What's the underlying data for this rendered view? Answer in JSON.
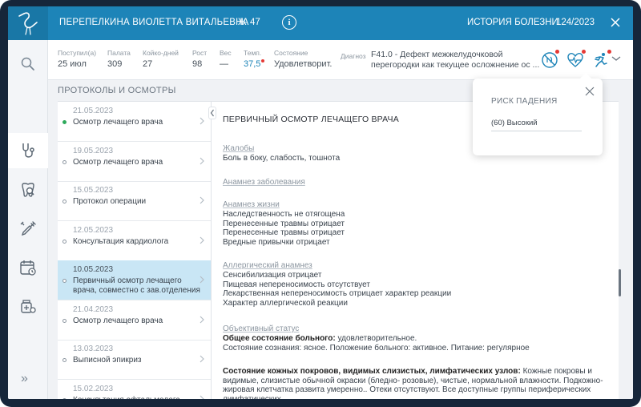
{
  "topbar": {
    "patient_name": "ПЕРЕПЕЛКИНА ВИОЛЕТТА ВИТАЛЬЕВНА",
    "sex": "Ж",
    "age": "47",
    "info_icon": "i",
    "history_label": "ИСТОРИЯ БОЛЕЗНИ",
    "history_number": "124/2023"
  },
  "patient_info": {
    "admitted_label": "Поступил(а)",
    "admitted_value": "25 июл",
    "ward_label": "Палата",
    "ward_value": "309",
    "bed_days_label": "Койко-дней",
    "bed_days_value": "27",
    "height_label": "Рост",
    "height_value": "98",
    "weight_label": "Вес",
    "weight_value": "—",
    "temp_label": "Темп.",
    "temp_value": "37,5",
    "state_label": "Состояние",
    "state_value": "Удовлетворит.",
    "diagnosis_label": "Диагноз",
    "diagnosis_value": "F41.0 - Дефект межжелудочковой перегородки как текущее осложнение ос ..."
  },
  "section_title": "ПРОТОКОЛЫ И ОСМОТРЫ",
  "protocols": [
    {
      "date": "21.05.2023",
      "title": "Осмотр лечащего врача",
      "marker": "green"
    },
    {
      "date": "19.05.2023",
      "title": "Осмотр лечащего врача",
      "marker": "empty"
    },
    {
      "date": "15.05.2023",
      "title": "Протокол операции",
      "marker": "empty"
    },
    {
      "date": "12.05.2023",
      "title": "Консультация кардиолога",
      "marker": "empty"
    },
    {
      "date": "10.05.2023",
      "title": "Первичный осмотр лечащего врача, совместно с зав.отделения",
      "marker": "empty",
      "active": true
    },
    {
      "date": "21.04.2023",
      "title": "Осмотр лечащего врача",
      "marker": "empty"
    },
    {
      "date": "13.03.2023",
      "title": "Выписной эпикриз",
      "marker": "empty"
    },
    {
      "date": "15.02.2023",
      "title": "Консультация офтальмолога",
      "marker": "empty"
    }
  ],
  "document": {
    "title": "ПЕРВИЧНЫЙ ОСМОТР ЛЕЧАЩЕГО ВРАЧА",
    "number_fragment": "45",
    "complaints_h": "Жалобы",
    "complaints": [
      "Боль в боку, слабость, тошнота"
    ],
    "disease_anamnesis_h": "Анамнез заболевания",
    "life_anamnesis_h": "Анамнез жизни",
    "life_anamnesis": [
      "Наследственность не отягощена",
      "Перенесенные травмы отрицает",
      "Перенесенные травмы отрицает",
      "Вредные привычки отрицает"
    ],
    "allergy_h": "Аллергический анамнез",
    "allergy": [
      "Сенсибилизация отрицает",
      "Пищевая непереносимость отсутствует",
      "Лекарственная непереносимость отрицает характер реакции",
      "Характер аллергической реакции"
    ],
    "objective_h": "Объективный статус",
    "general_state_label": "Общее состояние больного:",
    "general_state_value": "удовлетворительное.",
    "consciousness": "Состояние сознания: ясное. Положение больного: активное. Питание: регулярное",
    "skin_label": "Состояние кожных покровов, видимых слизистых, лимфатических узлов:",
    "skin_value": "Кожные покровы и видимые, слизистые обычной окраски (бледно- розовые), чистые, нормальной влажности. Подкожно-жировая клетчатка развита умеренно.. Отеки отсутствуют. Все доступные группы периферических лимфатических"
  },
  "fall_risk_popup": {
    "title": "РИСК ПАДЕНИЯ",
    "value": "(60) Высокий"
  },
  "rail": {
    "expand": "»"
  },
  "colors": {
    "brand": "#1d84b8",
    "active_item": "#c9e6f5",
    "alert": "#e53935",
    "status_green": "#2eaa5c"
  }
}
